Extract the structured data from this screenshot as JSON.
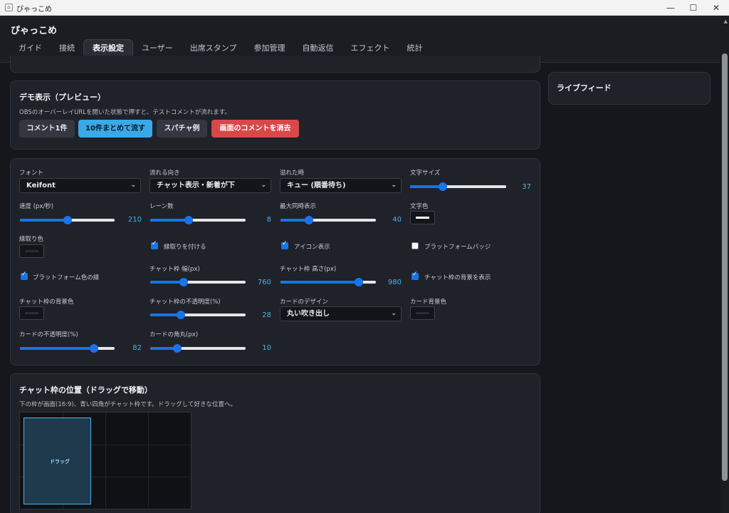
{
  "window": {
    "title": "ぴゃっこめ",
    "minimize": "—",
    "maximize": "☐",
    "close": "✕"
  },
  "app": {
    "title": "ぴゃっこめ"
  },
  "tabs": [
    "ガイド",
    "接続",
    "表示設定",
    "ユーザー",
    "出席スタンプ",
    "参加管理",
    "自動返信",
    "エフェクト",
    "統計"
  ],
  "demo": {
    "title": "デモ表示（プレビュー）",
    "description": "OBSのオーバーレイURLを開いた状態で押すと、テストコメントが流れます。",
    "buttons": {
      "one": "コメント1件",
      "ten": "10件まとめて流す",
      "superchat": "スパチャ例",
      "clear": "画面のコメントを消去"
    }
  },
  "settings": {
    "font_label": "フォント",
    "font_value": "Keifont",
    "direction_label": "流れる向き",
    "direction_value": "チャット表示・新着が下",
    "overflow_label": "溢れた時",
    "overflow_value": "キュー (順番待ち)",
    "text_size_label": "文字サイズ",
    "text_size_value": "37",
    "text_size_fraction": 0.34,
    "speed_label": "速度 (px/秒)",
    "speed_value": "210",
    "speed_fraction": 0.5,
    "lanes_label": "レーン数",
    "lanes_value": "8",
    "lanes_fraction": 0.4,
    "max_display_label": "最大同時表示",
    "max_display_value": "40",
    "max_display_fraction": 0.3,
    "text_color_label": "文字色",
    "text_color": "#ffffff",
    "outline_color_label": "縁取り色",
    "outline_color": "#2a2d35",
    "outline_enable_label": "縁取りを付ける",
    "icon_display_label": "アイコン表示",
    "platform_badge_label": "プラットフォームバッジ",
    "platform_color_outline_label": "プラットフォーム色の縁",
    "frame_width_label": "チャット枠 幅(px)",
    "frame_width_value": "760",
    "frame_width_fraction": 0.35,
    "frame_height_label": "チャット枠 高さ(px)",
    "frame_height_value": "980",
    "frame_height_fraction": 0.82,
    "frame_bg_show_label": "チャット枠の背景を表示",
    "frame_bg_color_label": "チャット枠の背景色",
    "frame_bg_color": "#2a2d35",
    "frame_opacity_label": "チャット枠の不透明度(%)",
    "frame_opacity_value": "28",
    "frame_opacity_fraction": 0.32,
    "card_design_label": "カードのデザイン",
    "card_design_value": "丸い吹き出し",
    "card_bg_color_label": "カード背景色",
    "card_bg_color": "#2a2d35",
    "card_opacity_label": "カードの不透明度(%)",
    "card_opacity_value": "82",
    "card_opacity_fraction": 0.78,
    "card_radius_label": "カードの角丸(px)",
    "card_radius_value": "10",
    "card_radius_fraction": 0.28
  },
  "position": {
    "title": "チャット枠の位置（ドラッグで移動）",
    "description": "下の枠が画面(16:9)、青い四角がチャット枠です。ドラッグして好きな位置へ。",
    "drag_label": "ドラッグ"
  },
  "livefeed": {
    "title": "ライブフィード"
  },
  "colors": {
    "accent": "#3aa9e8",
    "danger": "#d94848",
    "slider": "#1a73e8"
  }
}
